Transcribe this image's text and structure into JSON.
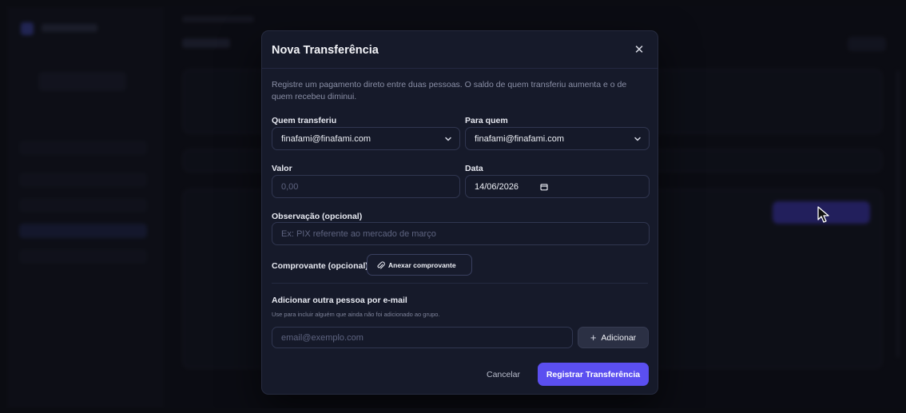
{
  "modal": {
    "title": "Nova Transferência",
    "close_icon": "close-icon",
    "description": "Registre um pagamento direto entre duas pessoas. O saldo de quem transferiu aumenta e o de quem recebeu diminui.",
    "from": {
      "label": "Quem transferiu",
      "value": "finafami@finafami.com"
    },
    "to": {
      "label": "Para quem",
      "value": "finafami@finafami.com"
    },
    "amount": {
      "label": "Valor",
      "placeholder": "0,00"
    },
    "date": {
      "label": "Data",
      "value": "14/06/2026"
    },
    "note": {
      "label": "Observação (opcional)",
      "placeholder": "Ex: PIX referente ao mercado de março"
    },
    "receipt": {
      "label": "Comprovante (opcional)",
      "button_label": "Anexar comprovante",
      "icon": "paperclip-icon"
    },
    "invite": {
      "heading": "Adicionar outra pessoa por e-mail",
      "hint": "Use para incluir alguém que ainda não foi adicionado ao grupo.",
      "placeholder": "email@exemplo.com",
      "button_label": "Adicionar",
      "button_icon": "+"
    },
    "actions": {
      "cancel_label": "Cancelar",
      "submit_label": "Registrar Transferência"
    }
  },
  "colors": {
    "accent": "#5b4ff0",
    "modal_bg": "#161a2a",
    "page_bg": "#0f1017"
  }
}
